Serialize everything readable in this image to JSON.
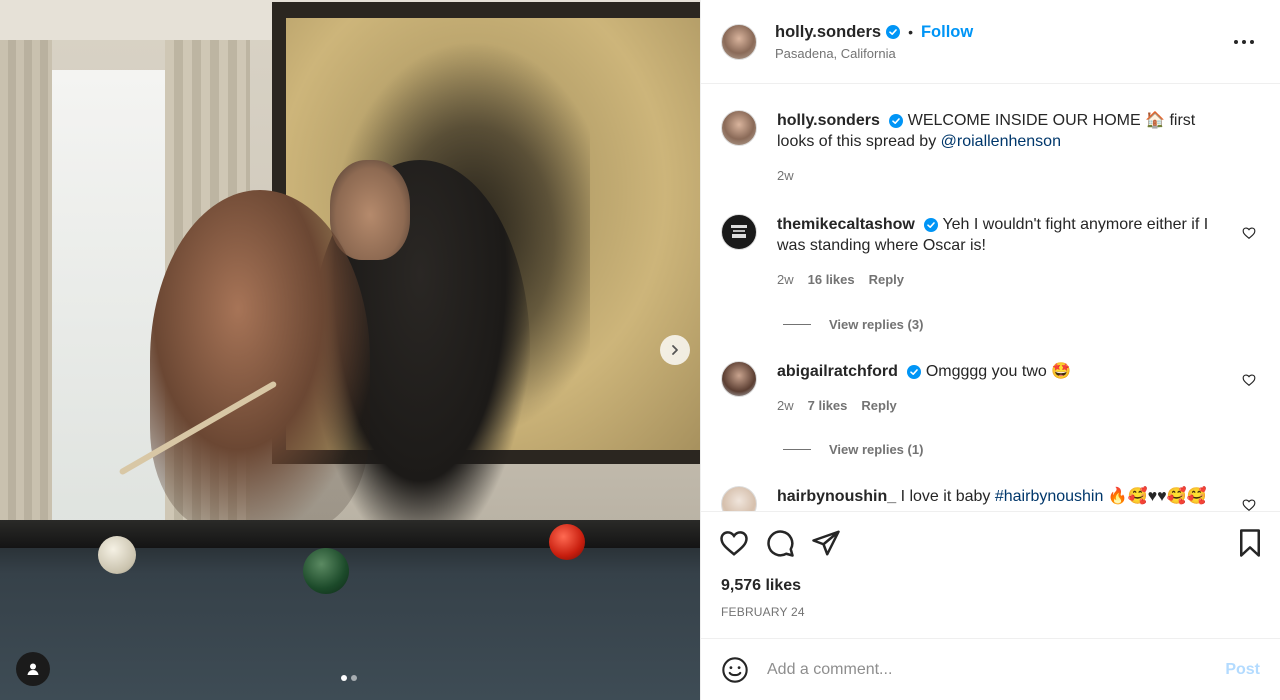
{
  "post": {
    "author": "holly.sonders",
    "follow_label": "Follow",
    "separator": "•",
    "location": "Pasadena, California",
    "likes": "9,576 likes",
    "date": "FEBRUARY 24",
    "carousel": {
      "total": 2,
      "current": 1
    }
  },
  "caption": {
    "username": "holly.sonders",
    "text_before": "WELCOME INSIDE OUR HOME 🏠 first looks of this spread by ",
    "mention": "@roiallenhenson",
    "time": "2w"
  },
  "comments": [
    {
      "username": "themikecaltashow",
      "text": "Yeh I wouldn't fight anymore either if I was standing where Oscar is!",
      "time": "2w",
      "likes": "16 likes",
      "reply_label": "Reply",
      "view_replies": "View replies (3)"
    },
    {
      "username": "abigailratchford",
      "text": "Omgggg you two 🤩",
      "time": "2w",
      "likes": "7 likes",
      "reply_label": "Reply",
      "view_replies": "View replies (1)"
    },
    {
      "username": "hairbynoushin_",
      "text_before": "I love it baby ",
      "hashtag": "#hairbynoushin",
      "text_after": " 🔥🥰♥♥🥰🥰"
    }
  ],
  "add_comment": {
    "placeholder": "Add a comment...",
    "post_label": "Post"
  },
  "colors": {
    "accent": "#0095f6",
    "link": "#00376b",
    "muted": "#737373",
    "post_disabled": "#b3dbff"
  },
  "icons": {
    "verified": "verified-badge-icon",
    "more": "more-options-icon",
    "like": "heart-icon",
    "comment": "comment-bubble-icon",
    "share": "paper-plane-icon",
    "save": "bookmark-icon",
    "emoji": "emoji-smiley-icon",
    "next": "chevron-right-icon",
    "tag": "user-tag-icon"
  }
}
